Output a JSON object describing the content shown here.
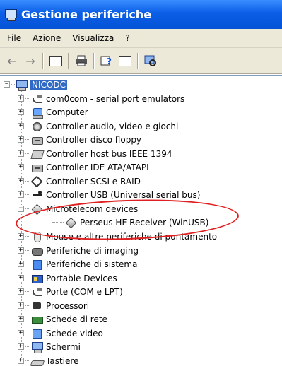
{
  "window": {
    "title": "Gestione periferiche"
  },
  "menu": {
    "file": "File",
    "azione": "Azione",
    "visualizza": "Visualizza",
    "help": "?"
  },
  "toolbar": {
    "back": "←",
    "forward": "→",
    "icons": [
      "properties-icon",
      "print-icon",
      "help-icon",
      "view-icon",
      "scan-hardware-icon"
    ]
  },
  "tree": {
    "root": {
      "label": "NICODC",
      "expander": "−"
    },
    "items": [
      {
        "label": "com0com - serial port emulators",
        "expander": "+",
        "icon": "plug-icon"
      },
      {
        "label": "Computer",
        "expander": "+",
        "icon": "computer-icon"
      },
      {
        "label": "Controller audio, video e giochi",
        "expander": "+",
        "icon": "audio-icon"
      },
      {
        "label": "Controller disco floppy",
        "expander": "+",
        "icon": "floppy-icon"
      },
      {
        "label": "Controller host bus IEEE 1394",
        "expander": "+",
        "icon": "ieee1394-icon"
      },
      {
        "label": "Controller IDE ATA/ATAPI",
        "expander": "+",
        "icon": "ide-icon"
      },
      {
        "label": "Controller SCSI e RAID",
        "expander": "+",
        "icon": "scsi-icon"
      },
      {
        "label": "Controller USB (Universal serial bus)",
        "expander": "+",
        "icon": "usb-icon"
      },
      {
        "label": "Microtelecom devices",
        "expander": "−",
        "icon": "device-icon"
      },
      {
        "label": "Perseus HF Receiver (WinUSB)",
        "expander": "",
        "icon": "device-icon"
      },
      {
        "label": "Mouse e altre periferiche di puntamento",
        "expander": "+",
        "icon": "mouse-icon"
      },
      {
        "label": "Periferiche di imaging",
        "expander": "+",
        "icon": "imaging-icon"
      },
      {
        "label": "Periferiche di sistema",
        "expander": "+",
        "icon": "system-icon"
      },
      {
        "label": "Portable Devices",
        "expander": "+",
        "icon": "portable-icon"
      },
      {
        "label": "Porte (COM e LPT)",
        "expander": "+",
        "icon": "port-icon"
      },
      {
        "label": "Processori",
        "expander": "+",
        "icon": "cpu-icon"
      },
      {
        "label": "Schede di rete",
        "expander": "+",
        "icon": "network-icon"
      },
      {
        "label": "Schede video",
        "expander": "+",
        "icon": "video-icon"
      },
      {
        "label": "Schermi",
        "expander": "+",
        "icon": "monitor-icon"
      },
      {
        "label": "Tastiere",
        "expander": "+",
        "icon": "keyboard-icon"
      }
    ]
  },
  "colors": {
    "titlebar": "#0a5ee6",
    "selection": "#316ac5",
    "annotation": "#e02020"
  }
}
